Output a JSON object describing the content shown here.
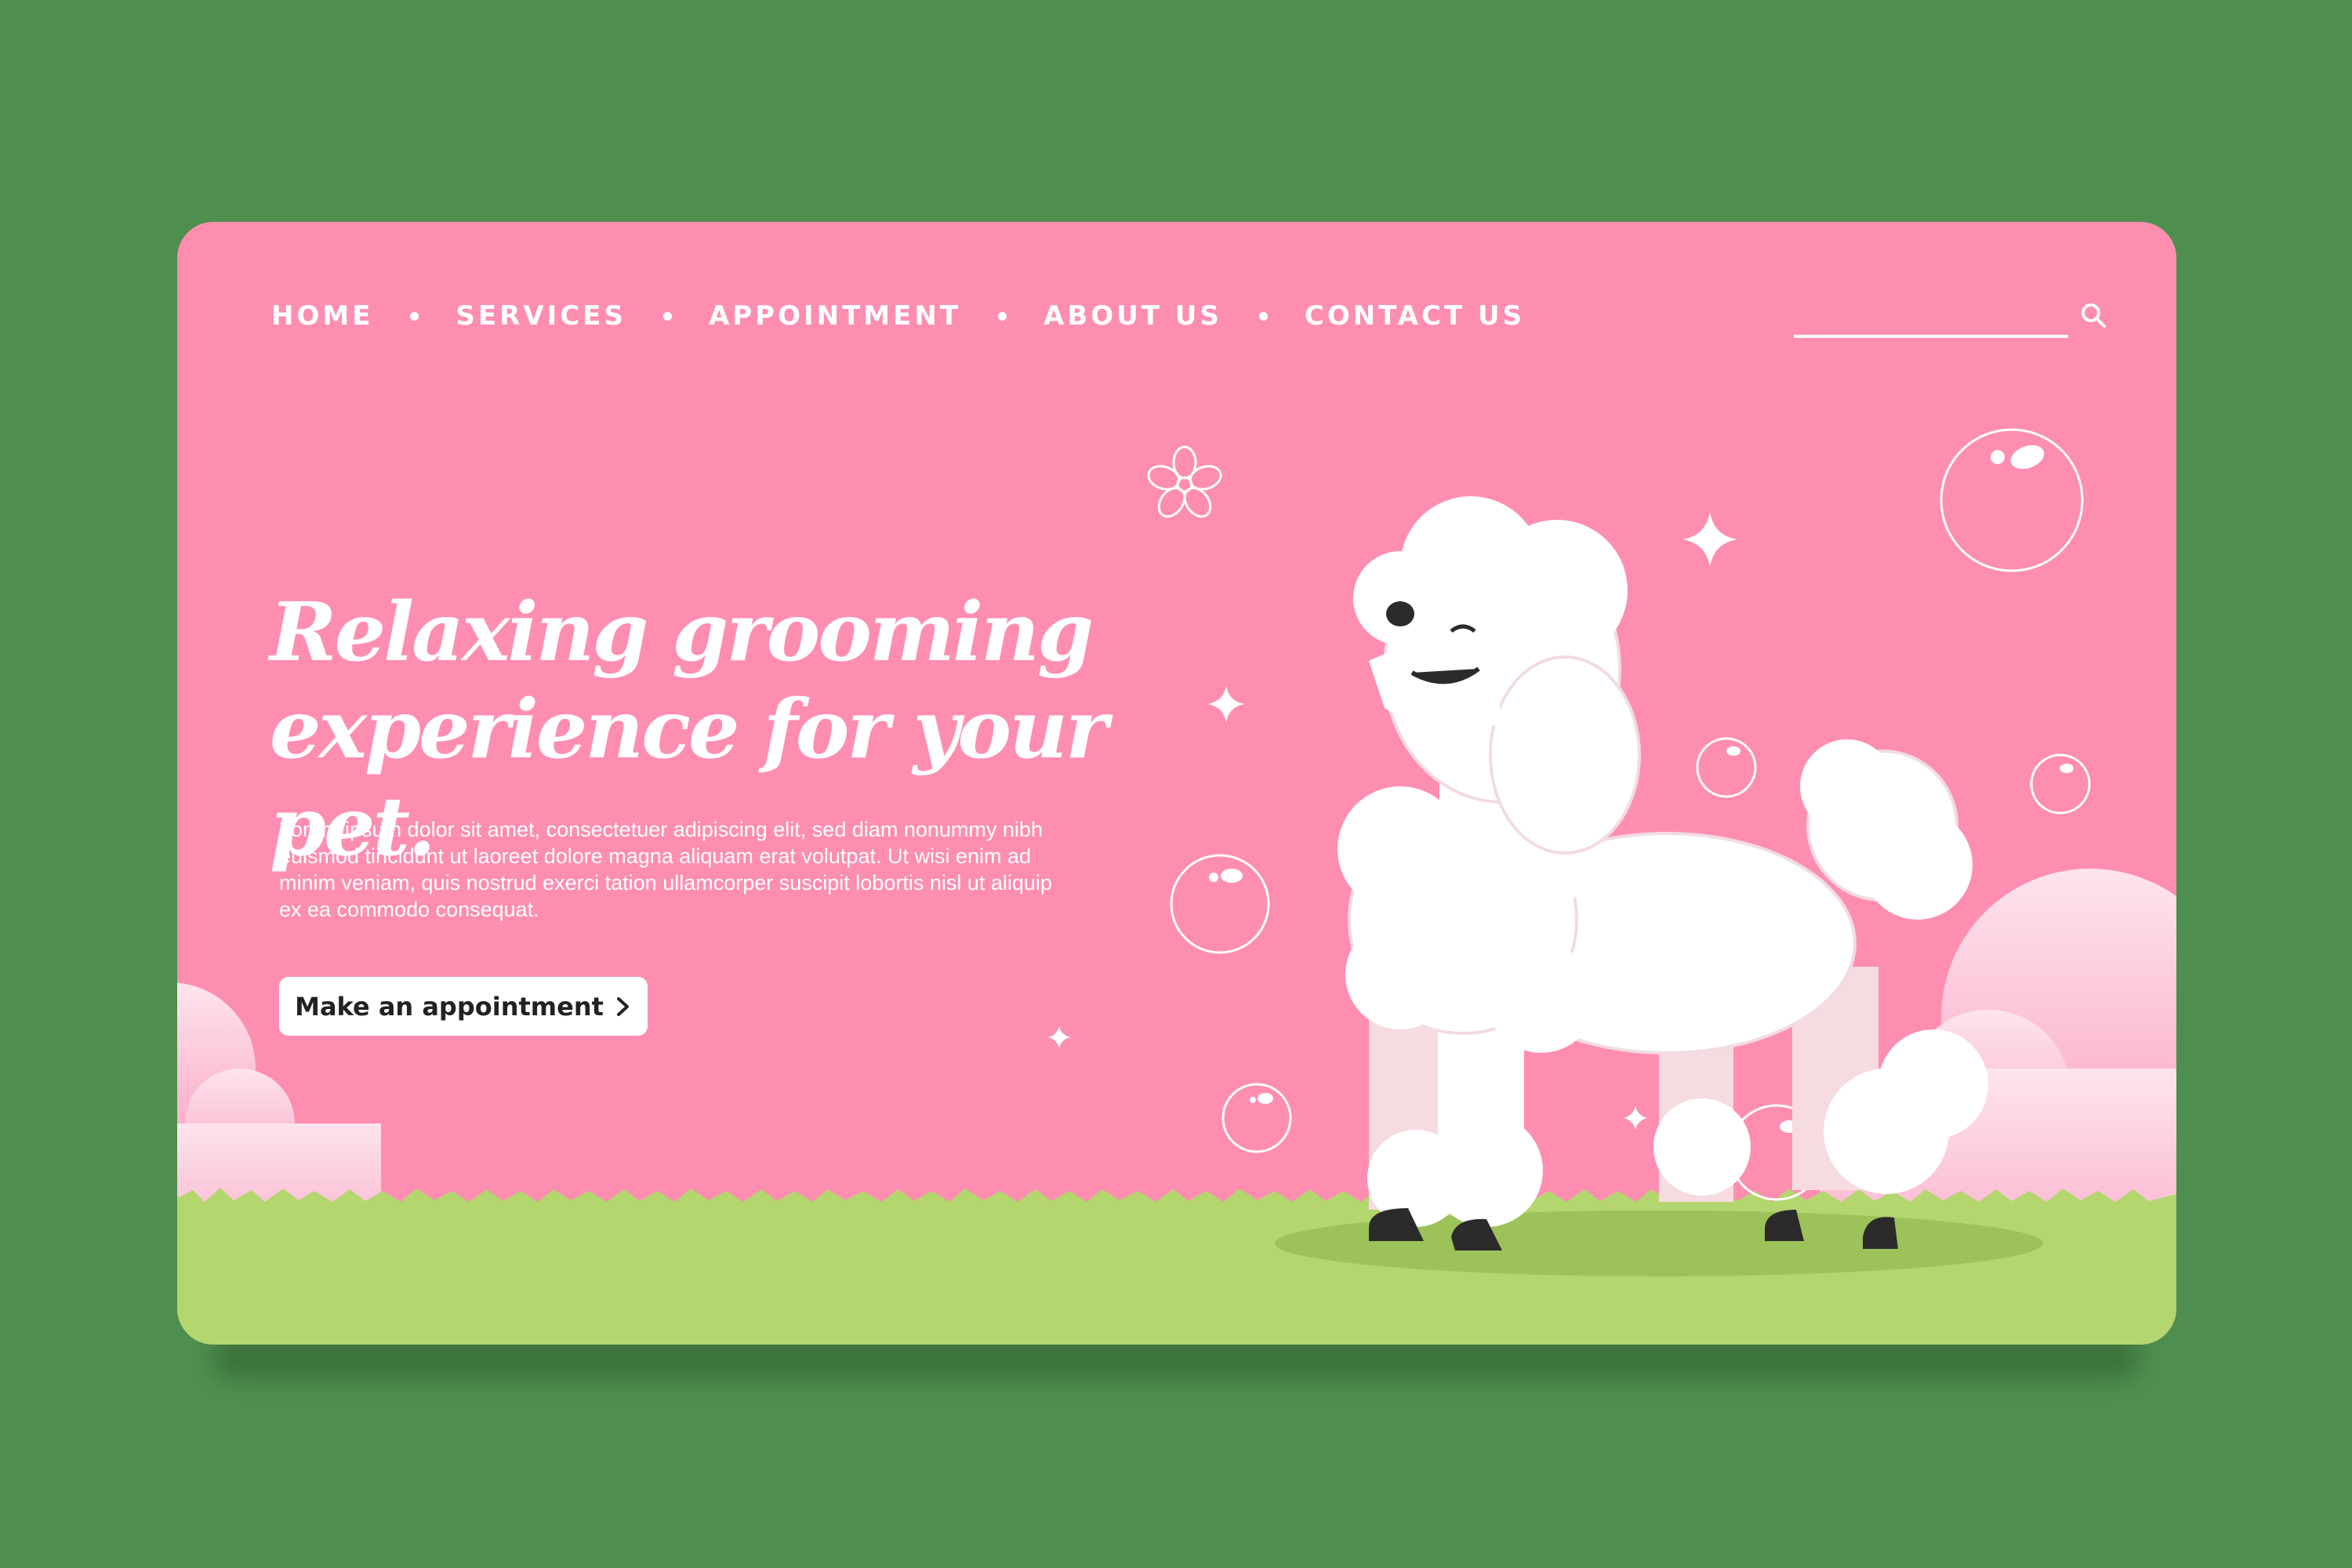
{
  "nav": {
    "items": [
      {
        "label": "HOME"
      },
      {
        "label": "SERVICES"
      },
      {
        "label": "APPOINTMENT"
      },
      {
        "label": "ABOUT US"
      },
      {
        "label": "CONTACT US"
      }
    ]
  },
  "search": {
    "placeholder": "",
    "value": "",
    "icon": "search-icon"
  },
  "hero": {
    "headline_line1": "Relaxing grooming",
    "headline_line2": "experience for your pet.",
    "body": "Lorem ipsum dolor sit amet, consectetuer adipiscing elit, sed diam nonummy nibh euismod tincidunt ut laoreet dolore magna aliquam erat volutpat. Ut wisi enim ad minim veniam, quis nostrud exerci tation ullamcorper suscipit lobortis nisl ut aliquip ex ea commodo consequat.",
    "cta_label": "Make an appointment",
    "cta_icon": "chevron-right-icon"
  },
  "colors": {
    "background": "#4e8e4e",
    "card": "#fe8eb0",
    "grass": "#b4d66f",
    "text": "#ffffff",
    "button_text": "#222222"
  }
}
